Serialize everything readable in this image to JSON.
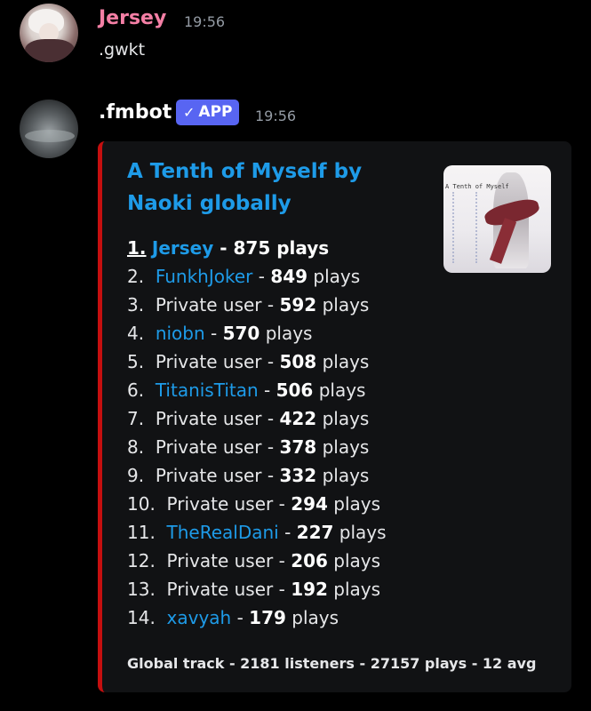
{
  "messages": [
    {
      "author": "Jersey",
      "author_color": "#f47fa5",
      "time": "19:56",
      "text": ".gwkt"
    },
    {
      "author": ".fmbot",
      "author_color": "#ffffff",
      "badge": "APP",
      "badge_icon": "check-icon",
      "time": "19:56"
    }
  ],
  "embed": {
    "accent": "#c50f0f",
    "title_line1": "A Tenth of Myself by",
    "title_line2": "Naoki globally",
    "thumbnail_text": "A Tenth of Myself",
    "leaderboard": [
      {
        "rank": "1.",
        "user": "Jersey",
        "plays": "875",
        "linked": true
      },
      {
        "rank": "2.",
        "user": "FunkhJoker",
        "plays": "849",
        "linked": true
      },
      {
        "rank": "3.",
        "user": "Private user",
        "plays": "592",
        "linked": false
      },
      {
        "rank": "4.",
        "user": "niobn",
        "plays": "570",
        "linked": true
      },
      {
        "rank": "5.",
        "user": "Private user",
        "plays": "508",
        "linked": false
      },
      {
        "rank": "6.",
        "user": "TitanisTitan",
        "plays": "506",
        "linked": true
      },
      {
        "rank": "7.",
        "user": "Private user",
        "plays": "422",
        "linked": false
      },
      {
        "rank": "8.",
        "user": "Private user",
        "plays": "378",
        "linked": false
      },
      {
        "rank": "9.",
        "user": "Private user",
        "plays": "332",
        "linked": false
      },
      {
        "rank": "10.",
        "user": "Private user",
        "plays": "294",
        "linked": false
      },
      {
        "rank": "11.",
        "user": "TheRealDani",
        "plays": "227",
        "linked": true
      },
      {
        "rank": "12.",
        "user": "Private user",
        "plays": "206",
        "linked": false
      },
      {
        "rank": "13.",
        "user": "Private user",
        "plays": "192",
        "linked": false
      },
      {
        "rank": "14.",
        "user": "xavyah",
        "plays": "179",
        "linked": true
      }
    ],
    "plays_word": "plays",
    "separator": "-",
    "footer": "Global track - 2181 listeners - 27157 plays - 12 avg"
  }
}
